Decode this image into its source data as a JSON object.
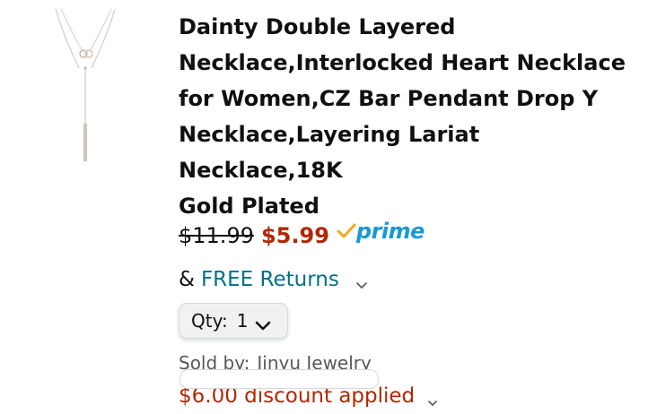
{
  "product": {
    "title": "Dainty Double Layered\nNecklace,Interlocked Heart Necklace\nfor Women,CZ Bar Pendant Drop Y\nNecklace,Layering Lariat Necklace,18K\nGold Plated",
    "thumbnail_icon": "necklace-image",
    "old_price": "$11.99",
    "new_price": "$5.99",
    "prime_label": "prime",
    "returns_prefix": "&",
    "returns_label": "FREE Returns",
    "qty_label": "Qty:",
    "qty_value": "1",
    "sold_by_label": "Sold by:",
    "seller": "Jinyu Jewelry",
    "discount_text": "$6.00 discount applied"
  },
  "colors": {
    "price_red": "#b12704",
    "link_teal": "#007185",
    "prime_blue": "#1a98d5",
    "prime_check": "#f8a51b",
    "text_dark": "#0f1111",
    "text_muted": "#565959"
  }
}
